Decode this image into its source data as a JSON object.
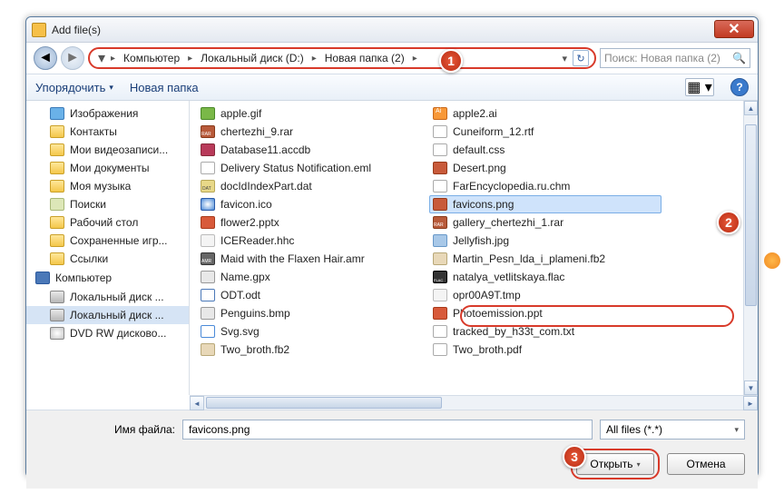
{
  "title": "Add file(s)",
  "breadcrumb": [
    "Компьютер",
    "Локальный диск (D:)",
    "Новая папка (2)"
  ],
  "search_placeholder": "Поиск: Новая папка (2)",
  "toolbar": {
    "organize": "Упорядочить",
    "newfolder": "Новая папка"
  },
  "sidebar": {
    "items": [
      {
        "label": "Изображения",
        "icon": "i-pics"
      },
      {
        "label": "Контакты",
        "icon": "i-folder"
      },
      {
        "label": "Мои видеозаписи...",
        "icon": "i-folder"
      },
      {
        "label": "Мои документы",
        "icon": "i-folder"
      },
      {
        "label": "Моя музыка",
        "icon": "i-folder"
      },
      {
        "label": "Поиски",
        "icon": "i-search"
      },
      {
        "label": "Рабочий стол",
        "icon": "i-folder"
      },
      {
        "label": "Сохраненные игр...",
        "icon": "i-folder"
      },
      {
        "label": "Ссылки",
        "icon": "i-folder"
      }
    ],
    "group": "Компьютер",
    "drives": [
      {
        "label": "Локальный диск ...",
        "icon": "i-disk"
      },
      {
        "label": "Локальный диск ...",
        "icon": "i-disk",
        "sel": true
      },
      {
        "label": "DVD RW дисково...",
        "icon": "i-dvd"
      }
    ]
  },
  "files_left": [
    {
      "name": "apple.gif",
      "icon": "fi-gif"
    },
    {
      "name": "chertezhi_9.rar",
      "icon": "fi-rar"
    },
    {
      "name": "Database11.accdb",
      "icon": "fi-db"
    },
    {
      "name": "Delivery Status Notification.eml",
      "icon": "fi-doc"
    },
    {
      "name": "docIdIndexPart.dat",
      "icon": "fi-dat"
    },
    {
      "name": "favicon.ico",
      "icon": "fi-ico"
    },
    {
      "name": "flower2.pptx",
      "icon": "fi-ppt"
    },
    {
      "name": "ICEReader.hhc",
      "icon": "fi-generic"
    },
    {
      "name": "Maid with the Flaxen Hair.amr",
      "icon": "fi-amr"
    },
    {
      "name": "Name.gpx",
      "icon": "fi-gpx"
    },
    {
      "name": "ODT.odt",
      "icon": "fi-odt"
    },
    {
      "name": "Penguins.bmp",
      "icon": "fi-bmp"
    },
    {
      "name": "Svg.svg",
      "icon": "fi-svg"
    },
    {
      "name": "Two_broth.fb2",
      "icon": "fi-fb2"
    }
  ],
  "files_right": [
    {
      "name": "apple2.ai",
      "icon": "fi-ai"
    },
    {
      "name": "Cuneiform_12.rtf",
      "icon": "fi-rtf"
    },
    {
      "name": "default.css",
      "icon": "fi-css"
    },
    {
      "name": "Desert.png",
      "icon": "fi-png"
    },
    {
      "name": "FarEncyclopedia.ru.chm",
      "icon": "fi-chm"
    },
    {
      "name": "favicons.png",
      "icon": "fi-sel",
      "sel": true
    },
    {
      "name": "gallery_chertezhi_1.rar",
      "icon": "fi-rar"
    },
    {
      "name": "Jellyfish.jpg",
      "icon": "fi-jpg"
    },
    {
      "name": "Martin_Pesn_lda_i_plameni.fb2",
      "icon": "fi-fb2"
    },
    {
      "name": "natalya_vetlitskaya.flac",
      "icon": "fi-flac"
    },
    {
      "name": "opr00A9T.tmp",
      "icon": "fi-tmp"
    },
    {
      "name": "Photoemission.ppt",
      "icon": "fi-ppt"
    },
    {
      "name": "tracked_by_h33t_com.txt",
      "icon": "fi-txt"
    },
    {
      "name": "Two_broth.pdf",
      "icon": "fi-pdf"
    }
  ],
  "filename_label": "Имя файла:",
  "filename_value": "favicons.png",
  "filter": "All files (*.*)",
  "open_label": "Открыть",
  "cancel_label": "Отмена",
  "badges": [
    "1",
    "2",
    "3"
  ]
}
